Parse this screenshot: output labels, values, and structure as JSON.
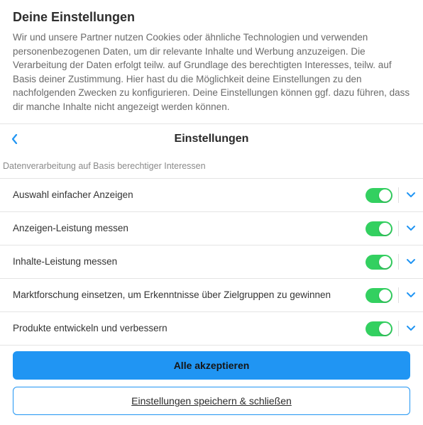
{
  "intro": {
    "title": "Deine Einstellungen",
    "body": "Wir und unsere Partner nutzen Cookies oder ähnliche Technologien und verwenden personenbezogenen Daten, um dir relevante Inhalte und Werbung anzuzeigen. Die Verarbeitung der Daten erfolgt teilw. auf Grundlage des berechtigten Interesses, teilw. auf Basis deiner Zustimmung. Hier hast du die Möglichkeit deine Einstellungen zu den nachfolgenden Zwecken zu konfigurieren. Deine Einstellungen können ggf. dazu führen, dass dir manche Inhalte nicht angezeigt werden können."
  },
  "header": {
    "title": "Einstellungen"
  },
  "section": {
    "label": "Datenverarbeitung auf Basis berechtiger Interessen"
  },
  "items": [
    {
      "label": "Auswahl einfacher Anzeigen",
      "on": true
    },
    {
      "label": "Anzeigen-Leistung messen",
      "on": true
    },
    {
      "label": "Inhalte-Leistung messen",
      "on": true
    },
    {
      "label": "Marktforschung einsetzen, um Erkenntnisse über Zielgruppen zu gewinnen",
      "on": true
    },
    {
      "label": "Produkte entwickeln und verbessern",
      "on": true
    }
  ],
  "buttons": {
    "accept_all": "Alle akzeptieren",
    "save_close": "Einstellungen speichern & schließen"
  },
  "colors": {
    "accent": "#2095f3",
    "toggle_on": "#33d060"
  }
}
